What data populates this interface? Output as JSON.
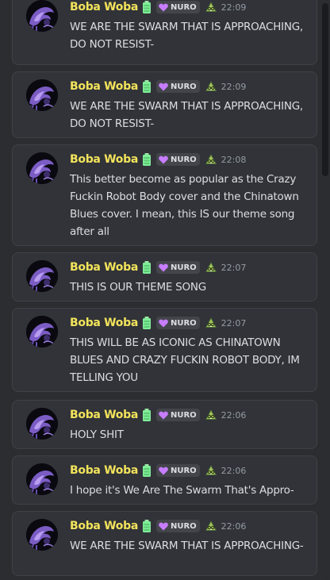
{
  "colors": {
    "background": "#2b2d31",
    "card": "#313338",
    "username": "#f2e35b",
    "text": "#dbdee1",
    "timestamp": "#949ba4",
    "tag_bg": "#43454b",
    "heart": "#c77dff",
    "battery": "#80ed99"
  },
  "icons": {
    "status": "battery-icon",
    "tag": "heart-icon",
    "badge": "nerd-face-icon"
  },
  "messages": [
    {
      "author": "Boba Woba",
      "tag": "NURO",
      "time": "22:09",
      "text": "WE ARE THE SWARM THAT IS APPROACHING, DO NOT RESIST-"
    },
    {
      "author": "Boba Woba",
      "tag": "NURO",
      "time": "22:09",
      "text": "WE ARE THE SWARM THAT IS APPROACHING, DO NOT RESIST-"
    },
    {
      "author": "Boba Woba",
      "tag": "NURO",
      "time": "22:08",
      "text": "This better become as popular as the Crazy Fuckin Robot Body cover and the Chinatown Blues cover. I mean, this IS our theme song after all"
    },
    {
      "author": "Boba Woba",
      "tag": "NURO",
      "time": "22:07",
      "text": "THIS IS OUR THEME SONG"
    },
    {
      "author": "Boba Woba",
      "tag": "NURO",
      "time": "22:07",
      "text": "THIS WILL BE AS ICONIC AS CHINATOWN BLUES AND CRAZY FUCKIN ROBOT BODY, IM TELLING YOU"
    },
    {
      "author": "Boba Woba",
      "tag": "NURO",
      "time": "22:06",
      "text": "HOLY SHIT"
    },
    {
      "author": "Boba Woba",
      "tag": "NURO",
      "time": "22:06",
      "text": "I hope it's We Are The Swarm That's Appro-"
    },
    {
      "author": "Boba Woba",
      "tag": "NURO",
      "time": "22:06",
      "text": "WE ARE THE SWARM THAT IS APPROACHING-"
    }
  ]
}
